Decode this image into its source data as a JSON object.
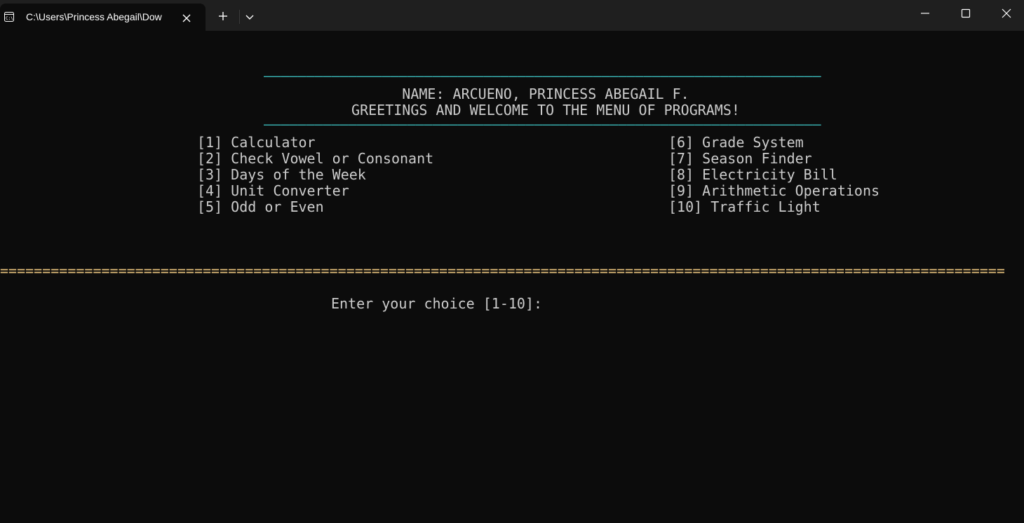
{
  "window": {
    "tab_title": "C:\\Users\\Princess Abegail\\Dow",
    "icons": {
      "tab": "terminal-icon",
      "close_tab": "close-icon",
      "new_tab": "plus-icon",
      "dropdown": "chevron-down-icon",
      "minimize": "minimize-icon",
      "maximize": "maximize-icon",
      "close": "close-icon"
    }
  },
  "console": {
    "rule_top": "——————————————————————————————————————————————————————————————————",
    "name_line": "NAME: ARCUENO, PRINCESS ABEGAIL F.",
    "greeting_line": "GREETINGS AND WELCOME TO THE MENU OF PROGRAMS!",
    "rule_bottom": "——————————————————————————————————————————————————————————————————",
    "menu_left": [
      "[1] Calculator",
      "[2] Check Vowel or Consonant",
      "[3] Days of the Week",
      "[4] Unit Converter",
      "[5] Odd or Even"
    ],
    "menu_right": [
      "[6] Grade System",
      "[7] Season Finder",
      "[8] Electricity Bill",
      "[9] Arithmetic Operations",
      "[10] Traffic Light"
    ],
    "eq_rule": "=======================================================================================================================",
    "prompt": "Enter your choice [1-10]: "
  },
  "colors": {
    "background": "#0c0c0c",
    "titlebar": "#1f1f1f",
    "text": "#cccccc",
    "cyan_rule": "#3ab6b6",
    "yellow_rule": "#e5c07b"
  }
}
